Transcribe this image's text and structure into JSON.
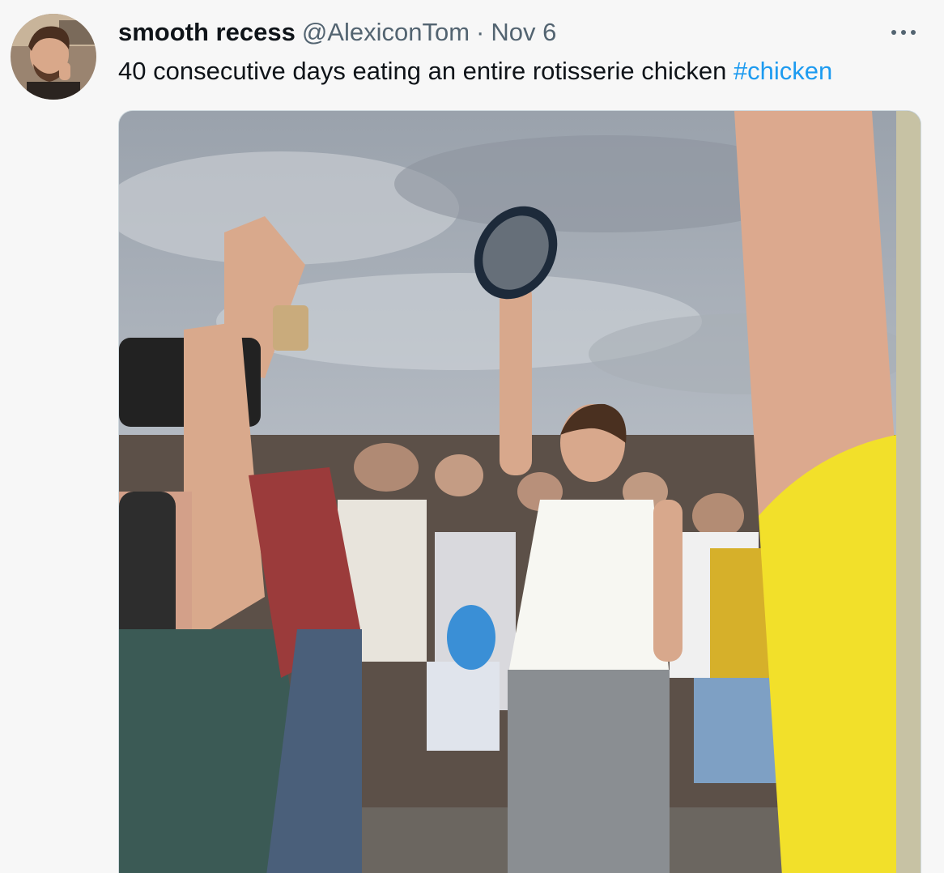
{
  "tweet": {
    "author": {
      "display_name": "smooth recess",
      "handle": "@AlexiconTom",
      "avatar_icon": "avatar-photo"
    },
    "separator": "·",
    "date": "Nov 6",
    "more_icon": "ellipsis-icon",
    "text": "40 consecutive days eating an entire rotisserie chicken",
    "hashtag": "#chicken",
    "media": {
      "type": "photo",
      "description_icon": "crowd-photo"
    }
  },
  "colors": {
    "text_primary": "#0f1419",
    "text_secondary": "#536471",
    "link": "#1d9bf0",
    "background": "#f7f7f7"
  }
}
